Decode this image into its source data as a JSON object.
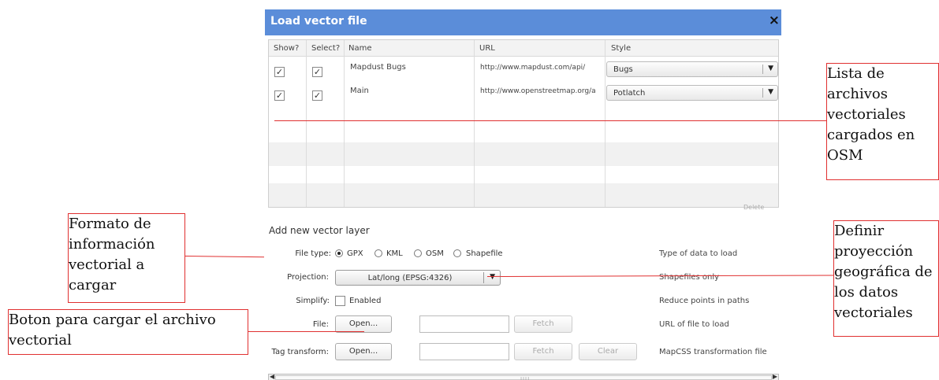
{
  "dialog": {
    "title": "Load vector file",
    "close_glyph": "×"
  },
  "table": {
    "headers": {
      "show": "Show?",
      "select": "Select?",
      "name": "Name",
      "url": "URL",
      "style": "Style"
    },
    "rows": [
      {
        "show": true,
        "select": true,
        "name": "Mapdust Bugs",
        "url": "http://www.mapdust.com/api/",
        "style": "Bugs"
      },
      {
        "show": true,
        "select": true,
        "name": "Main",
        "url": "http://www.openstreetmap.org/a",
        "style": "Potlatch"
      }
    ],
    "delete_label": "Delete"
  },
  "add_layer": {
    "title": "Add new vector layer",
    "file_type": {
      "label": "File type:",
      "options": [
        "GPX",
        "KML",
        "OSM",
        "Shapefile"
      ],
      "selected": "GPX",
      "help": "Type of data to load"
    },
    "projection": {
      "label": "Projection:",
      "value": "Lat/long (EPSG:4326)",
      "help": "Shapefiles only"
    },
    "simplify": {
      "label": "Simplify:",
      "checkbox_label": "Enabled",
      "checked": false,
      "help": "Reduce points in paths"
    },
    "file": {
      "label": "File:",
      "open_label": "Open...",
      "url_value": "",
      "fetch_label": "Fetch",
      "help": "URL of file to load"
    },
    "tag_transform": {
      "label": "Tag transform:",
      "open_label": "Open...",
      "url_value": "",
      "fetch_label": "Fetch",
      "clear_label": "Clear",
      "help": "MapCSS transformation file"
    }
  },
  "annotations": {
    "list": "Lista de archivos vectoriales cargados en OSM",
    "format": "Formato de información vectorial a cargar",
    "button": "Boton para cargar el archivo vectorial",
    "projection": "Definir proyección geográfica de los datos vectoriales"
  },
  "colors": {
    "titlebar": "#5b8dd9",
    "annotation_line": "#e03030"
  },
  "icons": {
    "check": "✓",
    "close": "close-icon",
    "dropdown": "chevron-down-icon"
  }
}
